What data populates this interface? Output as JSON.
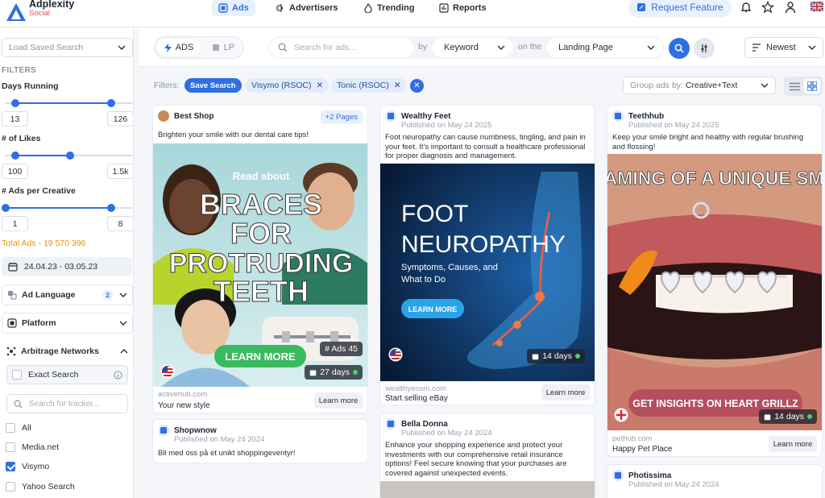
{
  "app": {
    "name": "Adplexity",
    "sub": "Social"
  },
  "nav": [
    {
      "label": "Ads"
    },
    {
      "label": "Advertisers"
    },
    {
      "label": "Trending"
    },
    {
      "label": "Reports"
    }
  ],
  "header": {
    "request": "Request Feature"
  },
  "sidebar": {
    "saved": "Load Saved Search",
    "filters": "FILTERS",
    "days": {
      "label": "Days Running",
      "min": "13",
      "max": "126"
    },
    "likes": {
      "label": "# of Likes",
      "min": "100",
      "max": "1.5k"
    },
    "per": {
      "label": "# Ads per Creative",
      "min": "1",
      "max": "8"
    },
    "total": "Total Ads - 19 570 396",
    "date": "24.04.23 - 03.05.23",
    "lang": {
      "label": "Ad Language",
      "count": "2"
    },
    "platform": "Platform",
    "arb": "Arbitrage Networks",
    "exact": "Exact Search",
    "tracker": "Search for tracker...",
    "networks": [
      {
        "label": "All",
        "checked": false
      },
      {
        "label": "Media.net",
        "checked": false
      },
      {
        "label": "Visymo",
        "checked": true
      },
      {
        "label": "Yahoo Search",
        "checked": false
      }
    ]
  },
  "toolbar": {
    "ads": "ADS",
    "lp": "LP",
    "search_ph": "Search for ads...",
    "by": "by",
    "mode": "Keyword",
    "on": "on the",
    "target": "Landing Page",
    "sort": "Newest"
  },
  "filterbar": {
    "label": "Filters:",
    "save": "Save Search",
    "chips": [
      "Visymo (RSOC)",
      "Tonic (RSOC)"
    ],
    "group_label": "Group ads by:",
    "group_value": "Creative+Text"
  },
  "cards": [
    {
      "name": "Best Shop",
      "more": "+2 Pages",
      "text": "Brighten your smile with our dental care tips!",
      "headline1": "Read about",
      "headline2": "BRACES",
      "headline3": "FOR",
      "headline4": "PROTRUDING",
      "headline5": "TEETH",
      "cta": "LEARN MORE",
      "ads": "# Ads 45",
      "days": "27 days",
      "domain": "activehub.com",
      "site": "Your new style",
      "btn": "Learn more"
    },
    {
      "name": "Wealthy Feet",
      "pub": "Published on May 24 2025",
      "text": "Foot neuropathy can cause numbness, tingling, and pain in your feet. It's important to consult a healthcare professional for proper diagnosis and management.",
      "h1": "FOOT",
      "h2": "NEUROPATHY",
      "sub": "Symptoms, Causes, and What to Do",
      "cta": "LEARN MORE",
      "days": "14 days",
      "domain": "wealthyecom.com",
      "site": "Start selling eBay",
      "btn": "Learn more"
    },
    {
      "name": "Teethhub",
      "pub": "Published on May 24 2025",
      "text": "Keep your smile bright and healthy with regular brushing and flossing!",
      "h1": "REAMING OF A UNIQUE SMILE",
      "cta": "GET INSIGHTS ON HEART GRILLZ",
      "days": "14 days",
      "domain": "pethub.com",
      "site": "Happy Pet Place",
      "btn": "Learn more"
    },
    {
      "name": "Shopwnow",
      "pub": "Published on May 24 2024",
      "text": "Bli med oss på et unikt shoppingeventyr!"
    },
    {
      "name": "Bella Donna",
      "pub": "Published on May 24 2024",
      "text": "Enhance your shopping experience and protect your investments with our comprehensive retail insurance options! Feel secure knowing that your purchases are covered against unexpected events."
    },
    {
      "name": "Photissima",
      "pub": "Published on May 24 2024"
    }
  ],
  "colors": {
    "accent": "#2f6fe4",
    "orange": "#e8900c"
  }
}
